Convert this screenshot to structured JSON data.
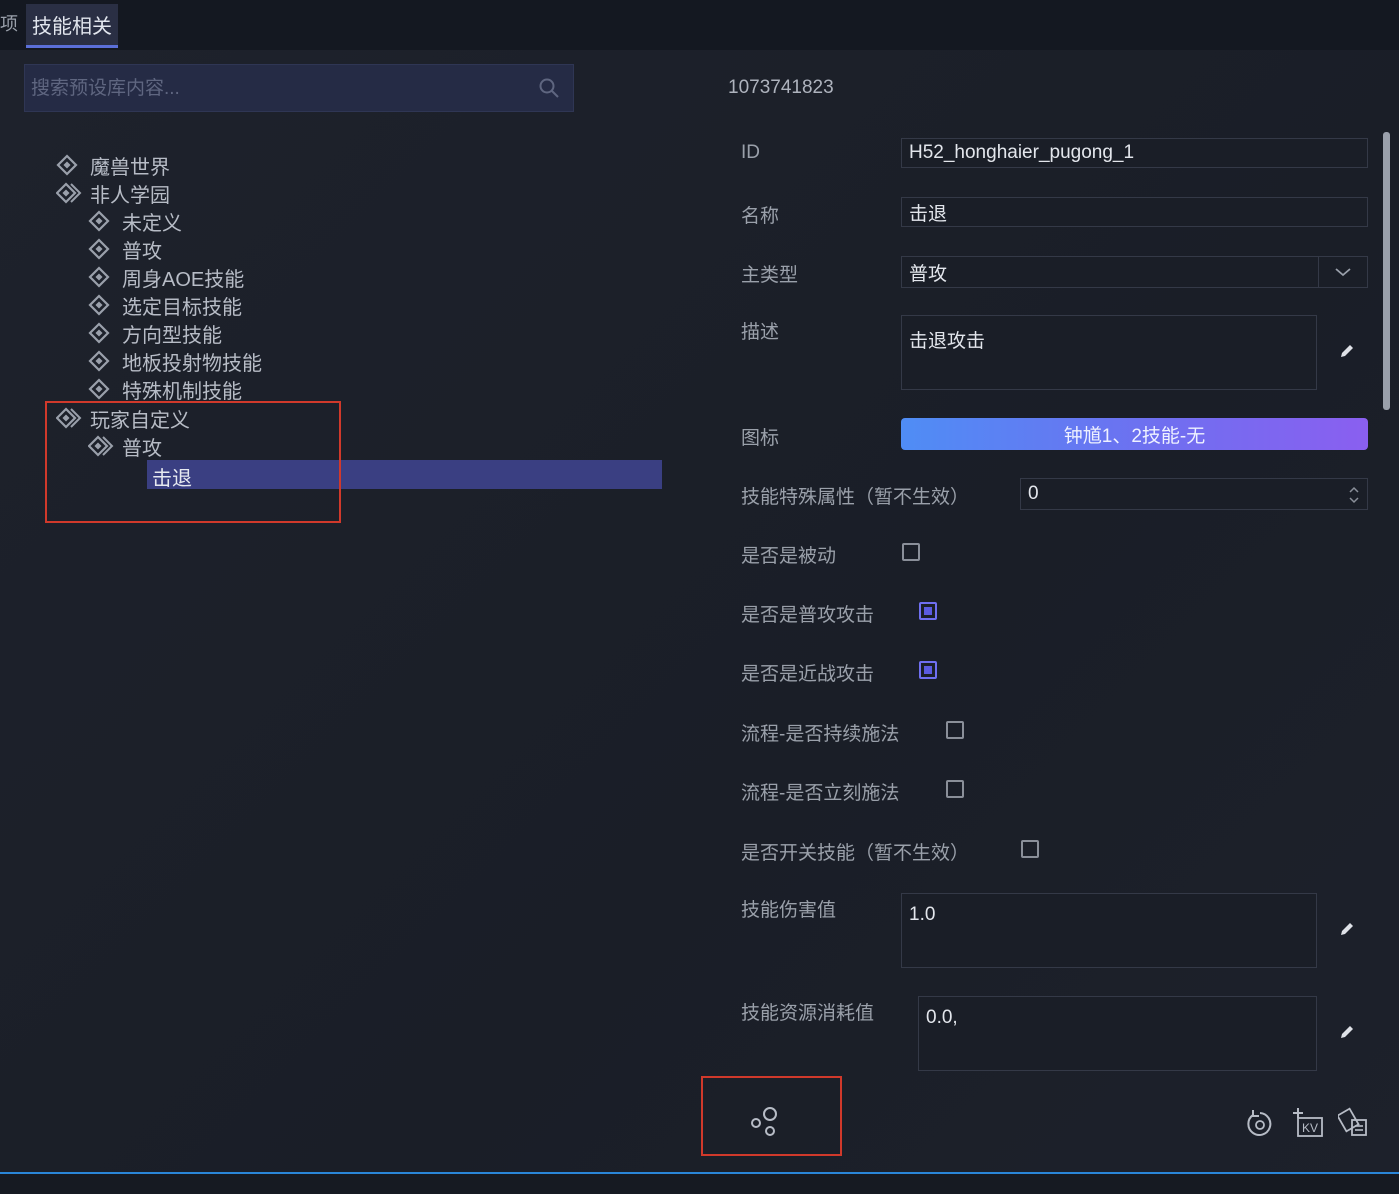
{
  "tabs": {
    "stub_label": "项",
    "active_label": "技能相关"
  },
  "search": {
    "placeholder": "搜索预设库内容..."
  },
  "tree": {
    "root1": "魔兽世界",
    "root2": "非人学园",
    "children2": [
      "未定义",
      "普攻",
      "周身AOE技能",
      "选定目标技能",
      "方向型技能",
      "地板投射物技能",
      "特殊机制技能"
    ],
    "root3": "玩家自定义",
    "child3": "普攻",
    "leaf": "击退"
  },
  "detail": {
    "title": "1073741823",
    "fields": {
      "id_label": "ID",
      "id_value": "H52_honghaier_pugong_1",
      "name_label": "名称",
      "name_value": "击退",
      "type_label": "主类型",
      "type_value": "普攻",
      "desc_label": "描述",
      "desc_value": "击退攻击",
      "icon_label": "图标",
      "icon_value": "钟馗1、2技能-无",
      "special_label": "技能特殊属性（暂不生效）",
      "special_value": "0",
      "passive_label": "是否是被动",
      "passive_checked": false,
      "normal_label": "是否是普攻攻击",
      "normal_checked": true,
      "melee_label": "是否是近战攻击",
      "melee_checked": true,
      "continuous_label": "流程-是否持续施法",
      "continuous_checked": false,
      "instant_label": "流程-是否立刻施法",
      "instant_checked": false,
      "toggle_label": "是否开关技能（暂不生效）",
      "toggle_checked": false,
      "damage_label": "技能伤害值",
      "damage_value": "1.0",
      "cost_label": "技能资源消耗值",
      "cost_value": "0.0,"
    }
  },
  "colors": {
    "accent": "#6f6ff0",
    "selection": "#3a3f82",
    "highlight_box": "#d0392b",
    "bottom_line": "#2a86d8"
  }
}
